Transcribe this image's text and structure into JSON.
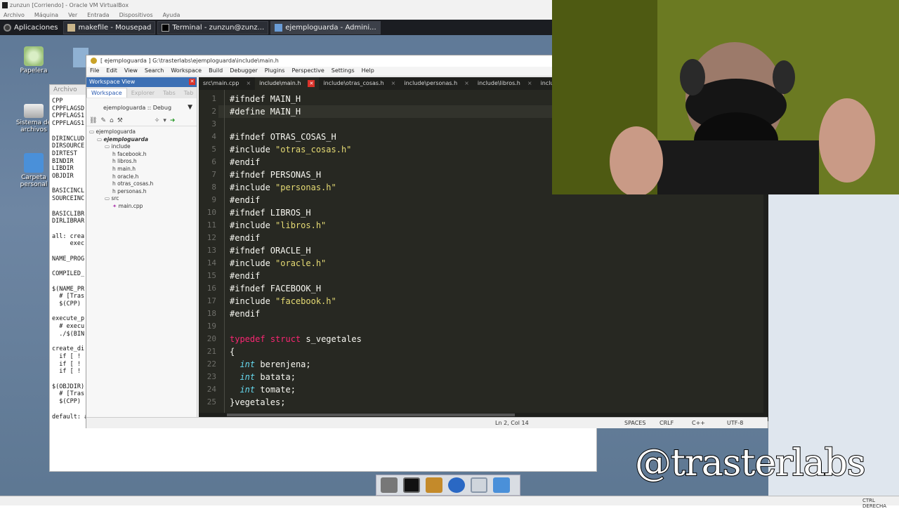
{
  "vbox": {
    "title": "zunzun [Corriendo] - Oracle VM VirtualBox",
    "menu": [
      "Archivo",
      "Máquina",
      "Ver",
      "Entrada",
      "Dispositivos",
      "Ayuda"
    ]
  },
  "taskbar": {
    "apps_label": "Aplicaciones",
    "items": [
      "makefile - Mousepad",
      "Terminal - zunzun@zunz...",
      "ejemploguarda - Admini..."
    ]
  },
  "desktop_icons": [
    "Papelera",
    "Sistema de archivos",
    "Carpeta personal"
  ],
  "mousepad": {
    "menu_first": "Archivo",
    "lines": [
      "CPP",
      "CPPFLAGSD",
      "CPPFLAGS1",
      "CPPFLAGS1",
      "",
      "DIRINCLUD",
      "DIRSOURCE",
      "DIRTEST",
      "BINDIR",
      "LIBDIR",
      "OBJDIR",
      "",
      "BASICINCL",
      "SOURCEINC",
      "",
      "BASICLIBR",
      "DIRLIBRAR",
      "",
      "all: crea",
      "     exec",
      "",
      "NAME_PROG",
      "",
      "COMPILED_",
      "",
      "$(NAME_PR",
      "  # [Tras",
      "  $(CPP)",
      "",
      "execute_p",
      "  # execu",
      "  ./$(BIN",
      "",
      "create_di",
      "  if [ !",
      "  if [ !",
      "  if [ !",
      "",
      "$(OBJDIR)",
      "  # [Tras",
      "  $(CPP)",
      "",
      "default: all"
    ]
  },
  "codeblocks": {
    "title": "[ ejemploguarda ] G:\\trasterlabs\\ejemploguarda\\include\\main.h",
    "menu": [
      "File",
      "Edit",
      "View",
      "Search",
      "Workspace",
      "Build",
      "Debugger",
      "Plugins",
      "Perspective",
      "Settings",
      "Help"
    ],
    "workspace": {
      "header": "Workspace View",
      "tabs": [
        "Workspace",
        "Explorer",
        "Tabs",
        "Tab"
      ],
      "target": "ejemploguarda :: Debug",
      "tree": [
        {
          "label": "ejemploguarda",
          "level": 0
        },
        {
          "label": "ejemploguarda",
          "level": 1,
          "bold": true
        },
        {
          "label": "include",
          "level": 2
        },
        {
          "label": "facebook.h",
          "level": 3
        },
        {
          "label": "libros.h",
          "level": 3
        },
        {
          "label": "main.h",
          "level": 3
        },
        {
          "label": "oracle.h",
          "level": 3
        },
        {
          "label": "otras_cosas.h",
          "level": 3
        },
        {
          "label": "personas.h",
          "level": 3
        },
        {
          "label": "src",
          "level": 2
        },
        {
          "label": "main.cpp",
          "level": 3
        }
      ]
    },
    "editor_tabs": [
      {
        "label": "src\\main.cpp",
        "active": false
      },
      {
        "label": "include\\main.h",
        "active": true
      },
      {
        "label": "include\\otras_cosas.h",
        "active": false
      },
      {
        "label": "include\\personas.h",
        "active": false
      },
      {
        "label": "include\\libros.h",
        "active": false
      },
      {
        "label": "include\\oracle",
        "active": false
      }
    ],
    "code_lines": [
      [
        [
          "pp",
          "#ifndef MAIN_H"
        ]
      ],
      [
        [
          "pp",
          "#define MAIN_H"
        ]
      ],
      [],
      [
        [
          "pp",
          "#ifndef OTRAS_COSAS_H"
        ]
      ],
      [
        [
          "pp",
          "#include "
        ],
        [
          "str",
          "\"otras_cosas.h\""
        ]
      ],
      [
        [
          "pp",
          "#endif"
        ]
      ],
      [
        [
          "pp",
          "#ifndef PERSONAS_H"
        ]
      ],
      [
        [
          "pp",
          "#include "
        ],
        [
          "str",
          "\"personas.h\""
        ]
      ],
      [
        [
          "pp",
          "#endif"
        ]
      ],
      [
        [
          "pp",
          "#ifndef LIBROS_H"
        ]
      ],
      [
        [
          "pp",
          "#include "
        ],
        [
          "str",
          "\"libros.h\""
        ]
      ],
      [
        [
          "pp",
          "#endif"
        ]
      ],
      [
        [
          "pp",
          "#ifndef ORACLE_H"
        ]
      ],
      [
        [
          "pp",
          "#include "
        ],
        [
          "str",
          "\"oracle.h\""
        ]
      ],
      [
        [
          "pp",
          "#endif"
        ]
      ],
      [
        [
          "pp",
          "#ifndef FACEBOOK_H"
        ]
      ],
      [
        [
          "pp",
          "#include "
        ],
        [
          "str",
          "\"facebook.h\""
        ]
      ],
      [
        [
          "pp",
          "#endif"
        ]
      ],
      [],
      [
        [
          "kw",
          "typedef"
        ],
        [
          "pp",
          " "
        ],
        [
          "kw",
          "struct"
        ],
        [
          "pp",
          " s_vegetales"
        ]
      ],
      [
        [
          "pp",
          "{"
        ]
      ],
      [
        [
          "pp",
          "  "
        ],
        [
          "ty",
          "int"
        ],
        [
          "pp",
          " berenjena;"
        ]
      ],
      [
        [
          "pp",
          "  "
        ],
        [
          "ty",
          "int"
        ],
        [
          "pp",
          " batata;"
        ]
      ],
      [
        [
          "pp",
          "  "
        ],
        [
          "ty",
          "int"
        ],
        [
          "pp",
          " tomate;"
        ]
      ],
      [
        [
          "pp",
          "}vegetales;"
        ]
      ]
    ],
    "status": {
      "position": "Ln 2, Col 14",
      "indent": "SPACES",
      "eol": "CRLF",
      "language": "C++",
      "encoding": "UTF-8"
    }
  },
  "watermark": "@trasterlabs",
  "host_status": "CTRL DERECHA",
  "colors": {
    "editor_bg": "#272822",
    "keyword": "#f92672",
    "type": "#66d9ef",
    "string": "#e6db74",
    "active_tab_close": "#d9322a"
  }
}
